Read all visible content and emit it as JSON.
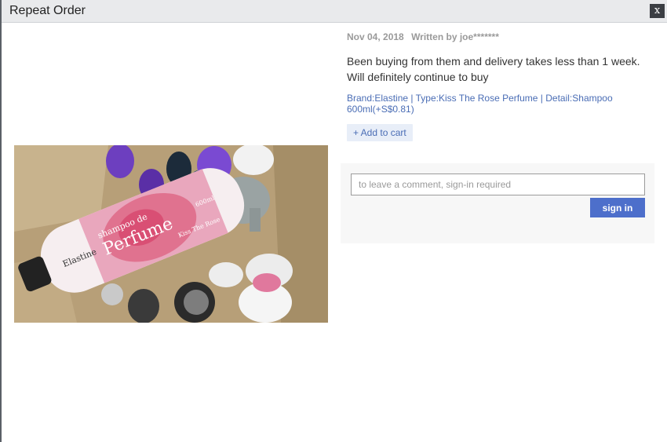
{
  "dialog": {
    "title": "Repeat Order",
    "close_label": "x"
  },
  "review": {
    "date": "Nov 04, 2018",
    "author": "Written by joe*******",
    "text": "Been buying from them and delivery takes less than 1 week. Will definitely continue to buy",
    "option": "Brand:Elastine | Type:Kiss The Rose Perfume | Detail:Shampoo 600ml(+S$0.81)",
    "add_to_cart": "+ Add to cart"
  },
  "comment": {
    "placeholder": "to leave a comment, sign-in required",
    "signin_label": "sign in"
  },
  "photo": {
    "bottle_brand": "Elastine",
    "bottle_text_1": "shampoo de",
    "bottle_text_2": "Perfume",
    "bottle_text_3": "Kiss The Rose",
    "bottle_volume": "600ml"
  },
  "colors": {
    "accent": "#4d6fcb",
    "link": "#4a6db5"
  }
}
